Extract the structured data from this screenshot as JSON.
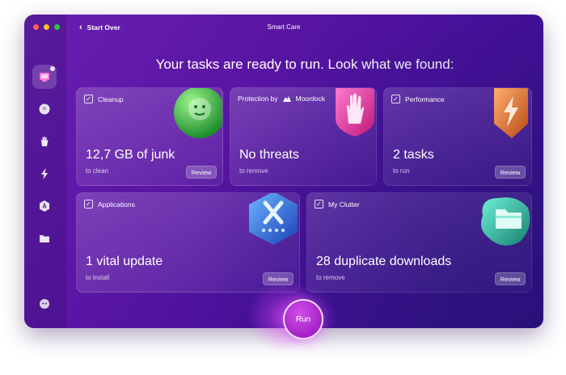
{
  "window": {
    "title": "Smart Care",
    "back_label": "Start Over"
  },
  "headline": "Your tasks are ready to run. Look what we found:",
  "sidebar": {
    "items": [
      {
        "icon": "smart-care-icon",
        "active": true
      },
      {
        "icon": "cleanup-icon"
      },
      {
        "icon": "protection-hand-icon"
      },
      {
        "icon": "performance-bolt-icon"
      },
      {
        "icon": "applications-icon"
      },
      {
        "icon": "folder-icon"
      }
    ],
    "bottom_icon": "assistant-icon"
  },
  "cards": {
    "cleanup": {
      "label": "Cleanup",
      "value": "12,7 GB of junk",
      "sub": "to clean",
      "button": "Review"
    },
    "protection": {
      "label": "Protection by",
      "brand": "Moonlock",
      "value": "No threats",
      "sub": "to remove"
    },
    "performance": {
      "label": "Performance",
      "value": "2 tasks",
      "sub": "to run",
      "button": "Review"
    },
    "applications": {
      "label": "Applications",
      "value": "1 vital update",
      "sub": "to install",
      "button": "Review"
    },
    "clutter": {
      "label": "My Clutter",
      "value": "28 duplicate downloads",
      "sub": "to remove",
      "button": "Review"
    }
  },
  "run_label": "Run",
  "colors": {
    "accent": "#b22ed6",
    "window_bg": "#5a15a4"
  }
}
